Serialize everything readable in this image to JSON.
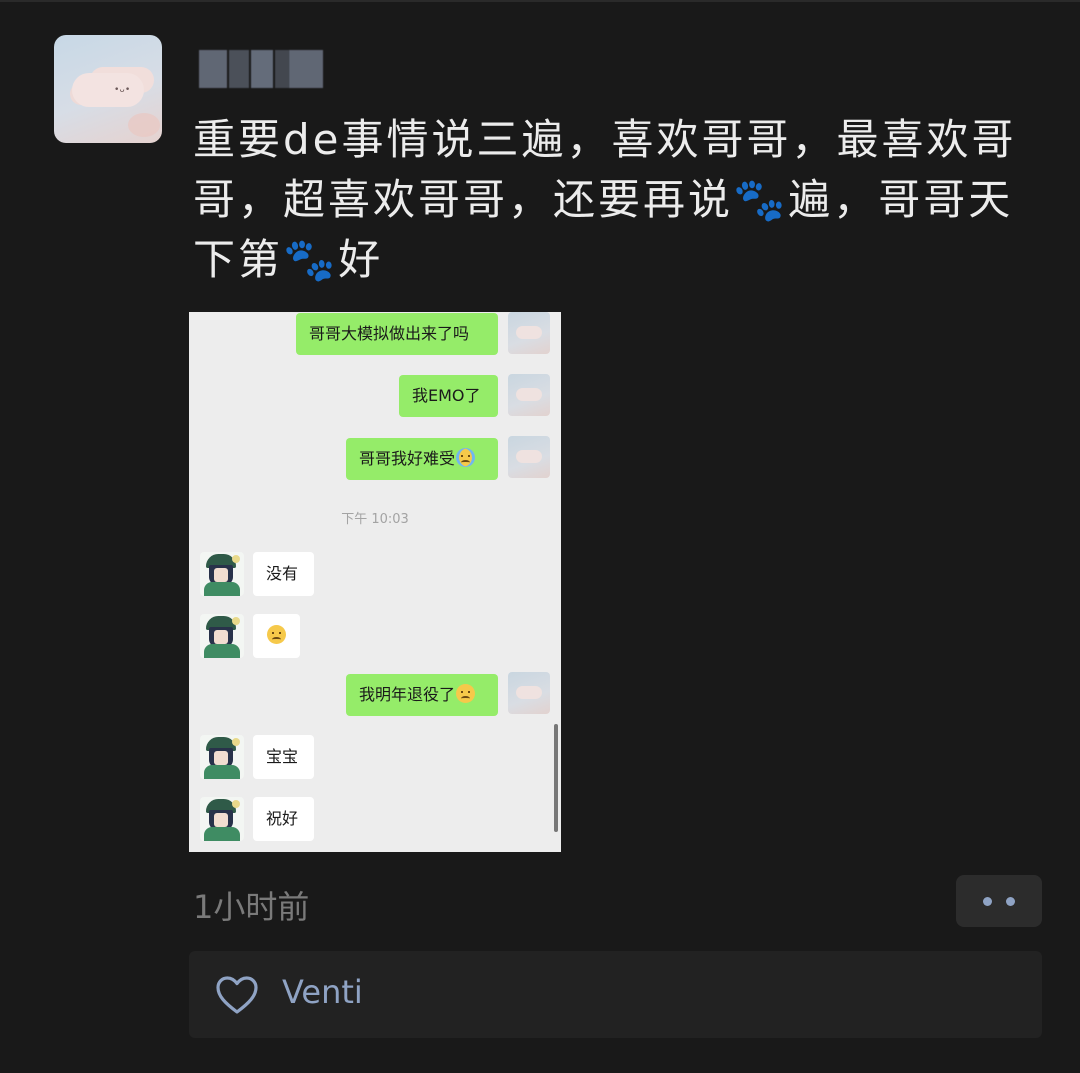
{
  "post": {
    "text": "重要de事情说三遍，喜欢哥哥，最喜欢哥哥，超喜欢哥哥，还要再说🐾遍，哥哥天下第🐾好",
    "time_ago": "1小时前",
    "likes": [
      "Venti"
    ]
  },
  "screenshot": {
    "messages": [
      {
        "side": "right",
        "text": "哥哥大模拟做出来了吗"
      },
      {
        "side": "right",
        "text": "我EMO了"
      },
      {
        "side": "right",
        "text": "哥哥我好难受",
        "emoji": "loudly-crying-emoji"
      },
      {
        "side": "left",
        "text": "没有"
      },
      {
        "side": "left",
        "text": "",
        "emoji": "worried-emoji"
      },
      {
        "side": "right",
        "text": "我明年退役了",
        "emoji": "worried-emoji"
      },
      {
        "side": "left",
        "text": "宝宝"
      },
      {
        "side": "left",
        "text": "祝好"
      }
    ],
    "timestamp": "下午 10:03"
  },
  "icons": {
    "like": "heart-icon",
    "more": "more-dots-icon"
  },
  "colors": {
    "background": "#191919",
    "bubble_sent": "#95ec69",
    "bubble_received": "#ffffff",
    "link_blue": "#8fa3c4"
  }
}
